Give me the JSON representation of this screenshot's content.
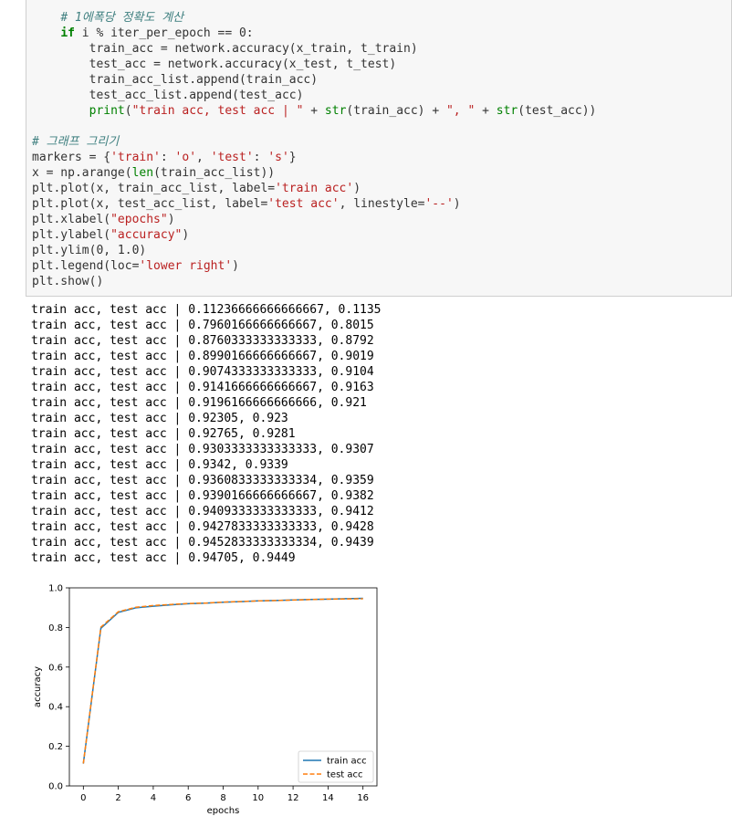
{
  "code_cell": {
    "lines": [
      {
        "indent": "    ",
        "parts": [
          {
            "t": "# 1에폭당 정확도 계산",
            "c": "cm"
          }
        ]
      },
      {
        "indent": "    ",
        "parts": [
          {
            "t": "if",
            "c": "kw"
          },
          {
            "t": " i % iter_per_epoch == 0:",
            "c": ""
          }
        ]
      },
      {
        "indent": "        ",
        "parts": [
          {
            "t": "train_acc = network.accuracy(x_train, t_train)",
            "c": ""
          }
        ]
      },
      {
        "indent": "        ",
        "parts": [
          {
            "t": "test_acc = network.accuracy(x_test, t_test)",
            "c": ""
          }
        ]
      },
      {
        "indent": "        ",
        "parts": [
          {
            "t": "train_acc_list.append(train_acc)",
            "c": ""
          }
        ]
      },
      {
        "indent": "        ",
        "parts": [
          {
            "t": "test_acc_list.append(test_acc)",
            "c": ""
          }
        ]
      },
      {
        "indent": "        ",
        "parts": [
          {
            "t": "print",
            "c": "bi"
          },
          {
            "t": "(",
            "c": ""
          },
          {
            "t": "\"train acc, test acc | \"",
            "c": "st"
          },
          {
            "t": " + ",
            "c": ""
          },
          {
            "t": "str",
            "c": "bi"
          },
          {
            "t": "(train_acc) + ",
            "c": ""
          },
          {
            "t": "\", \"",
            "c": "st"
          },
          {
            "t": " + ",
            "c": ""
          },
          {
            "t": "str",
            "c": "bi"
          },
          {
            "t": "(test_acc))",
            "c": ""
          }
        ]
      },
      {
        "indent": "",
        "parts": []
      },
      {
        "indent": "",
        "parts": [
          {
            "t": "# 그래프 그리기",
            "c": "cm"
          }
        ]
      },
      {
        "indent": "",
        "parts": [
          {
            "t": "markers = {",
            "c": ""
          },
          {
            "t": "'train'",
            "c": "st"
          },
          {
            "t": ": ",
            "c": ""
          },
          {
            "t": "'o'",
            "c": "st"
          },
          {
            "t": ", ",
            "c": ""
          },
          {
            "t": "'test'",
            "c": "st"
          },
          {
            "t": ": ",
            "c": ""
          },
          {
            "t": "'s'",
            "c": "st"
          },
          {
            "t": "}",
            "c": ""
          }
        ]
      },
      {
        "indent": "",
        "parts": [
          {
            "t": "x = np.arange(",
            "c": ""
          },
          {
            "t": "len",
            "c": "bi"
          },
          {
            "t": "(train_acc_list))",
            "c": ""
          }
        ]
      },
      {
        "indent": "",
        "parts": [
          {
            "t": "plt.plot(x, train_acc_list, label=",
            "c": ""
          },
          {
            "t": "'train acc'",
            "c": "st"
          },
          {
            "t": ")",
            "c": ""
          }
        ]
      },
      {
        "indent": "",
        "parts": [
          {
            "t": "plt.plot(x, test_acc_list, label=",
            "c": ""
          },
          {
            "t": "'test acc'",
            "c": "st"
          },
          {
            "t": ", linestyle=",
            "c": ""
          },
          {
            "t": "'--'",
            "c": "st"
          },
          {
            "t": ")",
            "c": ""
          }
        ]
      },
      {
        "indent": "",
        "parts": [
          {
            "t": "plt.xlabel(",
            "c": ""
          },
          {
            "t": "\"epochs\"",
            "c": "st"
          },
          {
            "t": ")",
            "c": ""
          }
        ]
      },
      {
        "indent": "",
        "parts": [
          {
            "t": "plt.ylabel(",
            "c": ""
          },
          {
            "t": "\"accuracy\"",
            "c": "st"
          },
          {
            "t": ")",
            "c": ""
          }
        ]
      },
      {
        "indent": "",
        "parts": [
          {
            "t": "plt.ylim(0, 1.0)",
            "c": ""
          }
        ]
      },
      {
        "indent": "",
        "parts": [
          {
            "t": "plt.legend(loc=",
            "c": ""
          },
          {
            "t": "'lower right'",
            "c": "st"
          },
          {
            "t": ")",
            "c": ""
          }
        ]
      },
      {
        "indent": "",
        "parts": [
          {
            "t": "plt.show()",
            "c": ""
          }
        ]
      }
    ]
  },
  "output": {
    "prefix": "train acc, test acc | ",
    "lines": [
      "0.11236666666666667, 0.1135",
      "0.7960166666666667, 0.8015",
      "0.8760333333333333, 0.8792",
      "0.8990166666666667, 0.9019",
      "0.9074333333333333, 0.9104",
      "0.9141666666666667, 0.9163",
      "0.9196166666666666, 0.921",
      "0.92305, 0.923",
      "0.92765, 0.9281",
      "0.9303333333333333, 0.9307",
      "0.9342, 0.9339",
      "0.9360833333333334, 0.9359",
      "0.9390166666666667, 0.9382",
      "0.9409333333333333, 0.9412",
      "0.9427833333333333, 0.9428",
      "0.9452833333333334, 0.9439",
      "0.94705, 0.9449"
    ]
  },
  "chart_data": {
    "type": "line",
    "x": [
      0,
      1,
      2,
      3,
      4,
      5,
      6,
      7,
      8,
      9,
      10,
      11,
      12,
      13,
      14,
      15,
      16
    ],
    "series": [
      {
        "name": "train acc",
        "color": "#1f77b4",
        "linestyle": "solid",
        "values": [
          0.11236666666666667,
          0.7960166666666667,
          0.8760333333333333,
          0.8990166666666667,
          0.9074333333333333,
          0.9141666666666667,
          0.9196166666666666,
          0.92305,
          0.92765,
          0.9303333333333333,
          0.9342,
          0.9360833333333334,
          0.9390166666666667,
          0.9409333333333333,
          0.9427833333333333,
          0.9452833333333334,
          0.94705
        ]
      },
      {
        "name": "test acc",
        "color": "#ff7f0e",
        "linestyle": "dashed",
        "values": [
          0.1135,
          0.8015,
          0.8792,
          0.9019,
          0.9104,
          0.9163,
          0.921,
          0.923,
          0.9281,
          0.9307,
          0.9339,
          0.9359,
          0.9382,
          0.9412,
          0.9428,
          0.9439,
          0.9449
        ]
      }
    ],
    "xlabel": "epochs",
    "ylabel": "accuracy",
    "xlim": [
      -0.8,
      16.8
    ],
    "ylim": [
      0,
      1.0
    ],
    "xticks": [
      0,
      2,
      4,
      6,
      8,
      10,
      12,
      14,
      16
    ],
    "xtick_labels": [
      "0",
      "2",
      "4",
      "6",
      "8",
      "10",
      "12",
      "14",
      "16"
    ],
    "yticks": [
      0,
      0.2,
      0.4,
      0.6,
      0.8,
      1.0
    ],
    "ytick_labels": [
      "0.0",
      "0.2",
      "0.4",
      "0.6",
      "0.8",
      "1.0"
    ],
    "legend": "lower right",
    "grid": false
  }
}
